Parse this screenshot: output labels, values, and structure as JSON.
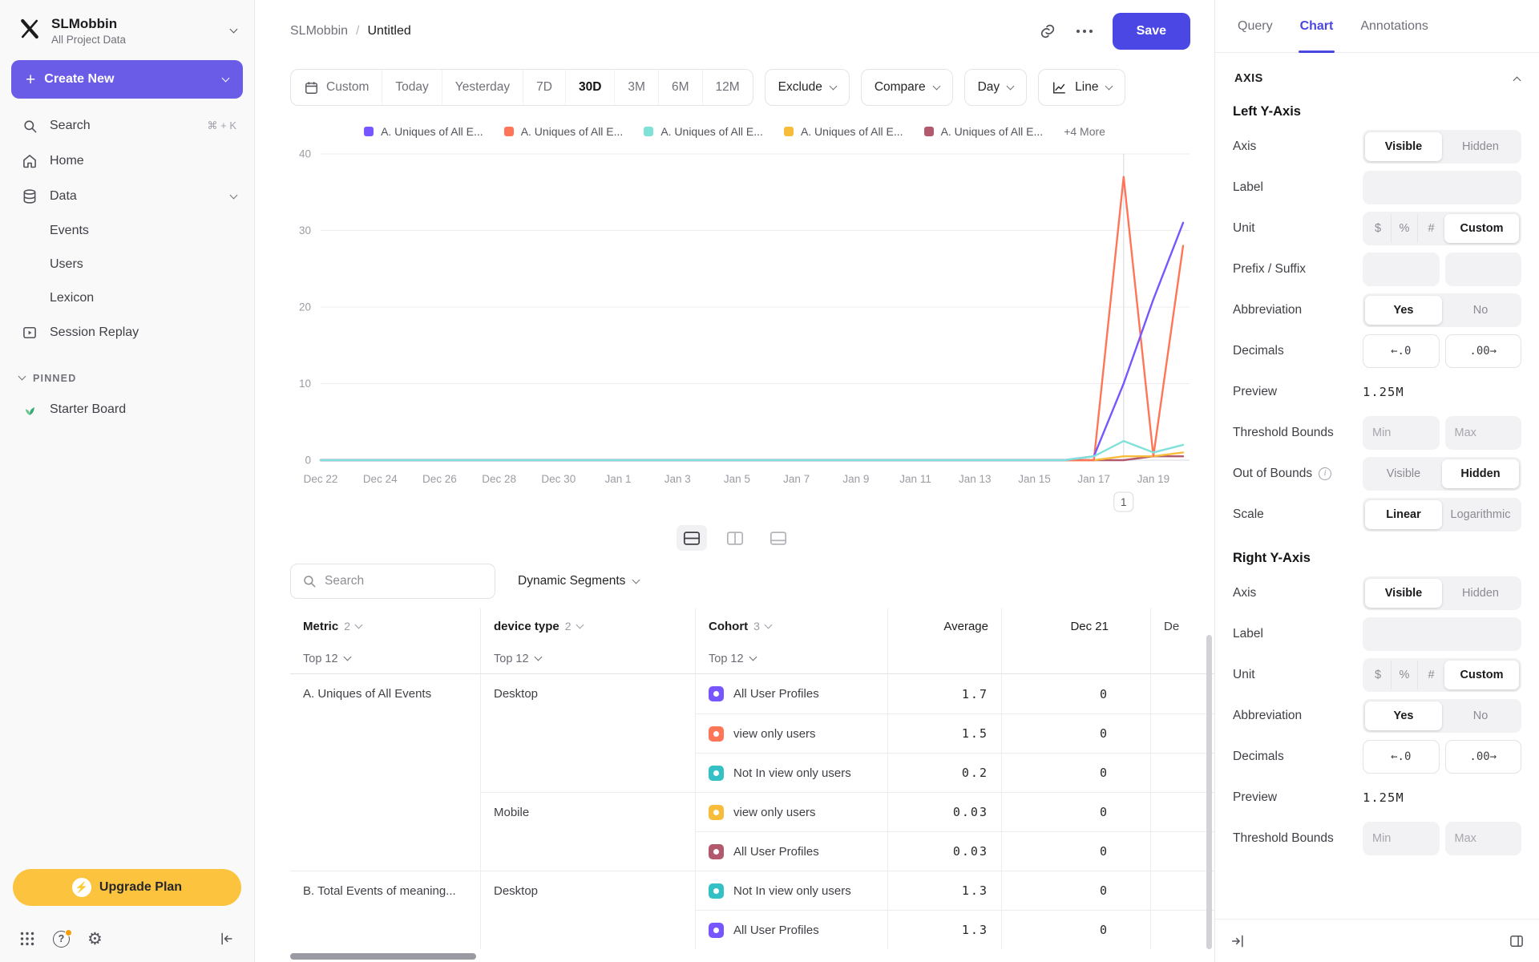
{
  "sidebar": {
    "workspace": {
      "name": "SLMobbin",
      "subtitle": "All Project Data"
    },
    "create": "Create New",
    "search": {
      "label": "Search",
      "shortcut": "⌘ + K"
    },
    "home": "Home",
    "data": "Data",
    "data_children": [
      "Events",
      "Users",
      "Lexicon"
    ],
    "session_replay": "Session Replay",
    "pinned_label": "PINNED",
    "pinned_items": [
      "Starter Board"
    ],
    "upgrade": "Upgrade Plan"
  },
  "header": {
    "breadcrumb_root": "SLMobbin",
    "breadcrumb_sep": "/",
    "breadcrumb_current": "Untitled",
    "save": "Save"
  },
  "toolbar": {
    "custom": "Custom",
    "ranges": [
      "Today",
      "Yesterday",
      "7D",
      "30D",
      "3M",
      "6M",
      "12M"
    ],
    "selected_range": "30D",
    "exclude": "Exclude",
    "compare": "Compare",
    "granularity": "Day",
    "chart_type": "Line"
  },
  "chart_data": {
    "type": "line",
    "x": [
      "Dec 22",
      "Dec 23",
      "Dec 24",
      "Dec 25",
      "Dec 26",
      "Dec 27",
      "Dec 28",
      "Dec 29",
      "Dec 30",
      "Dec 31",
      "Jan 1",
      "Jan 2",
      "Jan 3",
      "Jan 4",
      "Jan 5",
      "Jan 6",
      "Jan 7",
      "Jan 8",
      "Jan 9",
      "Jan 10",
      "Jan 11",
      "Jan 12",
      "Jan 13",
      "Jan 14",
      "Jan 15",
      "Jan 16",
      "Jan 17",
      "Jan 18",
      "Jan 19",
      "Jan 20"
    ],
    "ylim": [
      0,
      40
    ],
    "yticks": [
      0,
      10,
      20,
      30,
      40
    ],
    "grid": true,
    "legend_position": "top",
    "series": [
      {
        "name": "A. Uniques of All E...",
        "color": "#7856ff",
        "values": [
          0,
          0,
          0,
          0,
          0,
          0,
          0,
          0,
          0,
          0,
          0,
          0,
          0,
          0,
          0,
          0,
          0,
          0,
          0,
          0,
          0,
          0,
          0,
          0,
          0,
          0,
          0.5,
          10,
          21,
          31
        ]
      },
      {
        "name": "A. Uniques of All E...",
        "color": "#ff7557",
        "values": [
          0,
          0,
          0,
          0,
          0,
          0,
          0,
          0,
          0,
          0,
          0,
          0,
          0,
          0,
          0,
          0,
          0,
          0,
          0,
          0,
          0,
          0,
          0,
          0,
          0,
          0,
          0,
          37,
          0.5,
          28
        ]
      },
      {
        "name": "A. Uniques of All E...",
        "color": "#80e1d9",
        "values": [
          0,
          0,
          0,
          0,
          0,
          0,
          0,
          0,
          0,
          0,
          0,
          0,
          0,
          0,
          0,
          0,
          0,
          0,
          0,
          0,
          0,
          0,
          0,
          0,
          0,
          0,
          0.5,
          2.5,
          1,
          2
        ]
      },
      {
        "name": "A. Uniques of All E...",
        "color": "#f8bc3b",
        "values": [
          0,
          0,
          0,
          0,
          0,
          0,
          0,
          0,
          0,
          0,
          0,
          0,
          0,
          0,
          0,
          0,
          0,
          0,
          0,
          0,
          0,
          0,
          0,
          0,
          0,
          0,
          0,
          0.5,
          0.5,
          1
        ]
      },
      {
        "name": "A. Uniques of All E...",
        "color": "#b2596e",
        "values": [
          0,
          0,
          0,
          0,
          0,
          0,
          0,
          0,
          0,
          0,
          0,
          0,
          0,
          0,
          0,
          0,
          0,
          0,
          0,
          0,
          0,
          0,
          0,
          0,
          0,
          0,
          0,
          0,
          0.5,
          0.5
        ]
      }
    ],
    "legend_more": "+4 More",
    "annotation": {
      "x_index": 27,
      "label": "1"
    }
  },
  "table": {
    "search_placeholder": "Search",
    "segments_button": "Dynamic Segments",
    "columns": [
      {
        "label": "Metric",
        "count": "2"
      },
      {
        "label": "device type",
        "count": "2"
      },
      {
        "label": "Cohort",
        "count": "3"
      }
    ],
    "value_columns": [
      "Average",
      "Dec 21",
      "De"
    ],
    "top_filter": "Top 12",
    "rows": [
      {
        "metric": "A. Uniques of All Events",
        "device": "Desktop",
        "cohort": "All User Profiles",
        "color": "#7856ff",
        "average": "1.7",
        "dec21": "0"
      },
      {
        "cohort": "view only users",
        "color": "#ff7557",
        "average": "1.5",
        "dec21": "0"
      },
      {
        "cohort": "Not In view only users",
        "color": "#35c0c5",
        "average": "0.2",
        "dec21": "0"
      },
      {
        "device": "Mobile",
        "cohort": "view only users",
        "color": "#f8bc3b",
        "average": "0.03",
        "dec21": "0"
      },
      {
        "cohort": "All User Profiles",
        "color": "#b2596e",
        "average": "0.03",
        "dec21": "0"
      },
      {
        "metric": "B. Total Events of meaning...",
        "device": "Desktop",
        "cohort": "Not In view only users",
        "color": "#35c0c5",
        "average": "1.3",
        "dec21": "0"
      },
      {
        "cohort": "All User Profiles",
        "color": "#7856ff",
        "average": "1.3",
        "dec21": "0"
      }
    ]
  },
  "panel": {
    "tabs": [
      "Query",
      "Chart",
      "Annotations"
    ],
    "active_tab": "Chart",
    "section_title": "AXIS",
    "groups": [
      {
        "title": "Left Y-Axis",
        "rows": [
          {
            "label": "Axis",
            "type": "segmented",
            "options": [
              "Visible",
              "Hidden"
            ],
            "selected": 0
          },
          {
            "label": "Label",
            "type": "input",
            "placeholders": [
              ""
            ]
          },
          {
            "label": "Unit",
            "type": "segmented",
            "compact": true,
            "options": [
              "$",
              "%",
              "#",
              "Custom"
            ],
            "selected": 3
          },
          {
            "label": "Prefix / Suffix",
            "type": "inputs",
            "placeholders": [
              "",
              ""
            ]
          },
          {
            "label": "Abbreviation",
            "type": "segmented",
            "options": [
              "Yes",
              "No"
            ],
            "selected": 0
          },
          {
            "label": "Decimals",
            "type": "buttons",
            "options": [
              "←.0",
              ".00→"
            ]
          },
          {
            "label": "Preview",
            "type": "text",
            "value": "1.25M"
          },
          {
            "label": "Threshold Bounds",
            "type": "inputs",
            "placeholders": [
              "Min",
              "Max"
            ]
          },
          {
            "label": "Out of Bounds",
            "info": true,
            "type": "segmented",
            "options": [
              "Visible",
              "Hidden"
            ],
            "selected": 1
          },
          {
            "label": "Scale",
            "type": "segmented",
            "options": [
              "Linear",
              "Logarithmic"
            ],
            "selected": 0
          }
        ]
      },
      {
        "title": "Right Y-Axis",
        "rows": [
          {
            "label": "Axis",
            "type": "segmented",
            "options": [
              "Visible",
              "Hidden"
            ],
            "selected": 0
          },
          {
            "label": "Label",
            "type": "input",
            "placeholders": [
              ""
            ]
          },
          {
            "label": "Unit",
            "type": "segmented",
            "compact": true,
            "options": [
              "$",
              "%",
              "#",
              "Custom"
            ],
            "selected": 3
          },
          {
            "label": "Abbreviation",
            "type": "segmented",
            "options": [
              "Yes",
              "No"
            ],
            "selected": 0
          },
          {
            "label": "Decimals",
            "type": "buttons",
            "options": [
              "←.0",
              ".00→"
            ]
          },
          {
            "label": "Preview",
            "type": "text",
            "value": "1.25M"
          },
          {
            "label": "Threshold Bounds",
            "type": "inputs",
            "placeholders": [
              "Min",
              "Max"
            ]
          }
        ]
      }
    ]
  }
}
